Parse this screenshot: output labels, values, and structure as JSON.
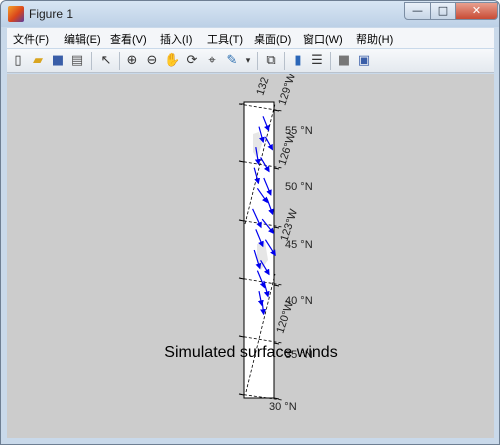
{
  "window": {
    "title": "Figure 1",
    "minimize_glyph": "—",
    "maximize_glyph": "□",
    "close_glyph": "✕"
  },
  "menu": [
    {
      "label": "文件(F)"
    },
    {
      "label": "编辑(E)"
    },
    {
      "label": "查看(V)"
    },
    {
      "label": "插入(I)"
    },
    {
      "label": "工具(T)"
    },
    {
      "label": "桌面(D)"
    },
    {
      "label": "窗口(W)"
    },
    {
      "label": "帮助(H)"
    }
  ],
  "toolbar": {
    "icons": [
      "new-figure-icon",
      "open-file-icon",
      "save-icon",
      "print-icon",
      "pointer-icon",
      "zoom-in-icon",
      "zoom-out-icon",
      "pan-icon",
      "rotate-icon",
      "data-cursor-icon",
      "brush-icon",
      "brush-dropdown-icon",
      "link-plot-icon",
      "colorbar-icon",
      "legend-icon",
      "hide-plot-tools-icon",
      "show-plot-tools-icon"
    ]
  },
  "figure": {
    "title": "Simulated surface winds",
    "lat_labels": [
      "55 °N",
      "50 °N",
      "45 °N",
      "40 °N",
      "35 °N",
      "30 °N"
    ],
    "lon_labels": [
      "132",
      "129°W",
      "126°W",
      "123°W",
      "120°W"
    ],
    "quiver_color": "#0000ee",
    "background_color": "#cccccc"
  },
  "chart_data": {
    "type": "quiver",
    "title": "Simulated surface winds",
    "lat_ticks": [
      55,
      50,
      45,
      40,
      35,
      30
    ],
    "lon_ticks": [
      -132,
      -129,
      -126,
      -123,
      -120
    ],
    "arrows": [
      {
        "lat": 56,
        "lon": -126.5,
        "u": 0.4,
        "v": -1.0
      },
      {
        "lat": 55,
        "lon": -127.0,
        "u": 0.3,
        "v": -1.1
      },
      {
        "lat": 54,
        "lon": -126.2,
        "u": 0.5,
        "v": -0.9
      },
      {
        "lat": 53,
        "lon": -127.4,
        "u": 0.2,
        "v": -1.2
      },
      {
        "lat": 52,
        "lon": -126.8,
        "u": 0.6,
        "v": -1.0
      },
      {
        "lat": 51,
        "lon": -127.6,
        "u": 0.3,
        "v": -1.1
      },
      {
        "lat": 50,
        "lon": -126.4,
        "u": 0.5,
        "v": -1.2
      },
      {
        "lat": 49,
        "lon": -127.2,
        "u": 0.7,
        "v": -1.0
      },
      {
        "lat": 48,
        "lon": -126.0,
        "u": 0.4,
        "v": -1.1
      },
      {
        "lat": 47,
        "lon": -127.8,
        "u": 0.6,
        "v": -1.3
      },
      {
        "lat": 46,
        "lon": -126.6,
        "u": 0.8,
        "v": -1.0
      },
      {
        "lat": 45,
        "lon": -127.4,
        "u": 0.5,
        "v": -1.2
      },
      {
        "lat": 44,
        "lon": -126.2,
        "u": 0.7,
        "v": -1.1
      },
      {
        "lat": 43,
        "lon": -127.6,
        "u": 0.4,
        "v": -1.3
      },
      {
        "lat": 42,
        "lon": -126.8,
        "u": 0.6,
        "v": -1.0
      },
      {
        "lat": 41,
        "lon": -127.2,
        "u": 0.5,
        "v": -1.2
      },
      {
        "lat": 40,
        "lon": -126.4,
        "u": 0.3,
        "v": -1.1
      },
      {
        "lat": 39,
        "lon": -127.0,
        "u": 0.2,
        "v": -1.0
      },
      {
        "lat": 38,
        "lon": -126.6,
        "u": 0.1,
        "v": -0.9
      }
    ]
  }
}
